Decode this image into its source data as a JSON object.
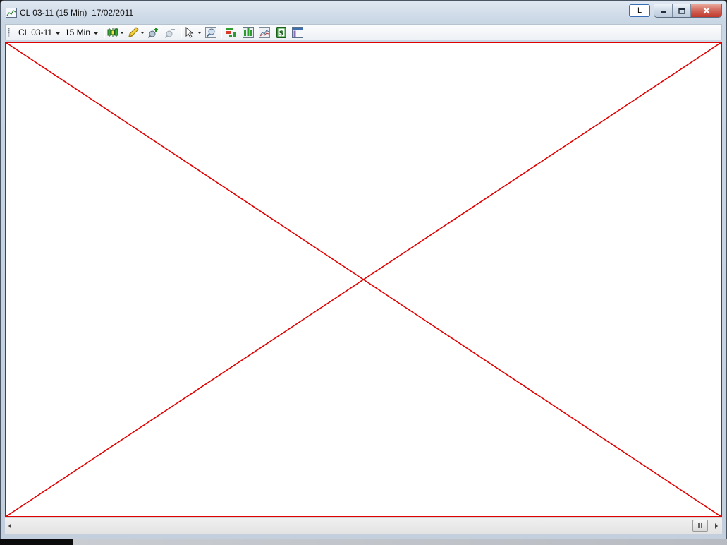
{
  "window": {
    "title": "CL 03-11 (15 Min)  17/02/2011",
    "title_icon": "chart-window-icon",
    "caption_buttons": {
      "link_label": "L",
      "minimize_icon": "minimize-icon",
      "restore_icon": "restore-icon",
      "close_icon": "close-icon"
    }
  },
  "toolbar": {
    "instrument_value": "CL 03-11",
    "interval_value": "15 Min",
    "icons": [
      "candlestick-chart-icon",
      "pencil-drawing-icon",
      "zoom-in-icon",
      "zoom-out-icon",
      "cursor-select-icon",
      "magnifier-icon",
      "indicators-icon",
      "strategies-icon",
      "chart-properties-icon",
      "dollar-pnl-icon",
      "data-box-icon"
    ]
  },
  "chart": {
    "state": "empty",
    "error_cross_color": "#e00000"
  },
  "scrollbar": {
    "left_arrow_icon": "scroll-left-icon",
    "right_arrow_icon": "scroll-right-icon",
    "thumb_icon": "scroll-thumb-grip-icon"
  }
}
